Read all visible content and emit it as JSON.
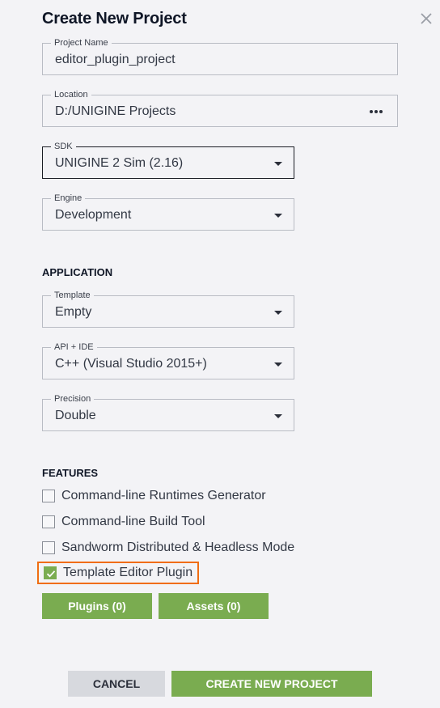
{
  "dialog": {
    "title": "Create New Project",
    "close_icon": "close-icon"
  },
  "fields": {
    "project_name": {
      "label": "Project Name",
      "value": "editor_plugin_project"
    },
    "location": {
      "label": "Location",
      "value": "D:/UNIGINE Projects",
      "browse_icon": "more-horizontal-icon"
    },
    "sdk": {
      "label": "SDK",
      "value": "UNIGINE 2 Sim (2.16)"
    },
    "engine": {
      "label": "Engine",
      "value": "Development"
    }
  },
  "application": {
    "heading": "APPLICATION",
    "template": {
      "label": "Template",
      "value": "Empty"
    },
    "api_ide": {
      "label": "API + IDE",
      "value": "C++ (Visual Studio 2015+)"
    },
    "precision": {
      "label": "Precision",
      "value": "Double"
    }
  },
  "features": {
    "heading": "FEATURES",
    "items": [
      {
        "label": "Command-line Runtimes Generator",
        "checked": false
      },
      {
        "label": "Command-line Build Tool",
        "checked": false
      },
      {
        "label": "Sandworm Distributed & Headless Mode",
        "checked": false
      },
      {
        "label": "Template Editor Plugin",
        "checked": true
      }
    ],
    "plugins_button": "Plugins (0)",
    "assets_button": "Assets (0)"
  },
  "footer": {
    "cancel_label": "CANCEL",
    "create_label": "CREATE NEW PROJECT"
  },
  "colors": {
    "accent_green": "#7aac50",
    "highlight_orange": "#f06d12",
    "background": "#f3f3f6"
  }
}
